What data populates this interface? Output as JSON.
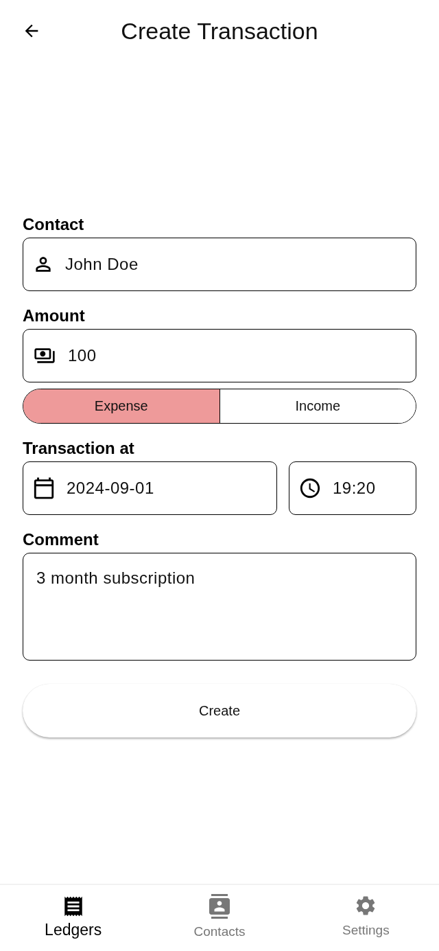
{
  "header": {
    "title": "Create Transaction"
  },
  "contact": {
    "label": "Contact",
    "value": "John Doe"
  },
  "amount": {
    "label": "Amount",
    "value": "100"
  },
  "type_options": [
    {
      "label": "Expense",
      "selected": true
    },
    {
      "label": "Income",
      "selected": false
    }
  ],
  "transaction_at": {
    "label": "Transaction at",
    "date": "2024-09-01",
    "time": "19:20"
  },
  "comment": {
    "label": "Comment",
    "value": "3 month subscription"
  },
  "create_button": "Create",
  "nav": [
    {
      "kind": "ledgers",
      "label": "Ledgers",
      "selected": true
    },
    {
      "kind": "contacts",
      "label": "Contacts",
      "selected": false
    },
    {
      "kind": "settings",
      "label": "Settings",
      "selected": false
    }
  ]
}
